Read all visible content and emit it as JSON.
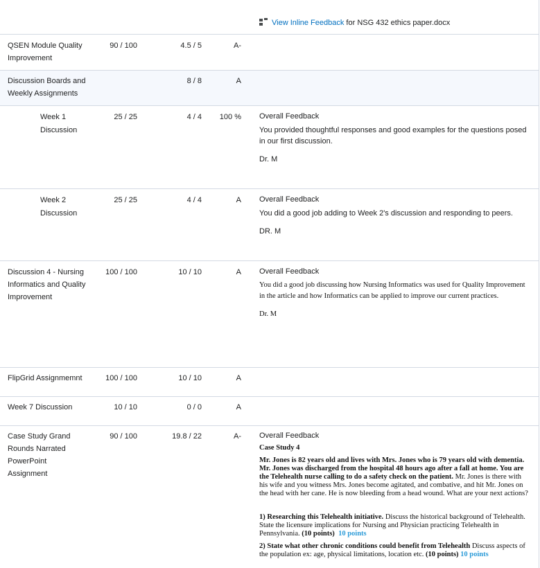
{
  "header": {
    "link_label": "View Inline Feedback",
    "link_suffix": " for NSG 432 ethics paper.docx"
  },
  "rows": {
    "qsen": {
      "name": "QSEN Module Quality Improvement",
      "points": "90 / 100",
      "weight": "4.5 / 5",
      "grade": "A-"
    },
    "discussion_boards": {
      "name": "Discussion Boards and Weekly Assignments",
      "points": "",
      "weight": "8 / 8",
      "grade": "A"
    },
    "week1": {
      "name": "Week 1 Discussion",
      "points": "25 / 25",
      "weight": "4 / 4",
      "grade": "100 %",
      "feedback_title": "Overall Feedback",
      "feedback_text": "You provided  thoughtful responses and good examples for the questions posed in our first discussion.",
      "feedback_sign": "Dr. M"
    },
    "week2": {
      "name": "Week 2 Discussion",
      "points": "25 / 25",
      "weight": "4 / 4",
      "grade": "A",
      "feedback_title": "Overall Feedback",
      "feedback_text": "You did a good job adding to Week 2's discussion and responding to peers.",
      "feedback_sign": "DR. M"
    },
    "disc4": {
      "name": "Discussion 4 - Nursing Informatics and Quality Improvement",
      "points": "100 / 100",
      "weight": "10 / 10",
      "grade": "A",
      "feedback_title": "Overall Feedback",
      "feedback_text": "You did a good job discussing how Nursing Informatics was used for Quality Improvement in the article and how Informatics can be applied to improve our current practices.",
      "feedback_sign": "Dr. M"
    },
    "flipgrid": {
      "name": "FlipGrid Assignmemnt",
      "points": "100 / 100",
      "weight": "10 / 10",
      "grade": "A"
    },
    "week7": {
      "name": "Week 7 Discussion",
      "points": "10 / 10",
      "weight": "0 / 0",
      "grade": "A"
    },
    "case_study": {
      "name": "Case Study Grand Rounds Narrated PowerPoint Assignment",
      "points": "90 / 100",
      "weight": "19.8 / 22",
      "grade": "A-",
      "feedback_title": "Overall Feedback",
      "case_title": "Case Study 4",
      "case_bold": "Mr. Jones is 82 years old and lives with Mrs. Jones who is 79 years old with dementia. Mr. Jones was discharged from the hospital 48 hours ago after a fall at home. You are the Telehealth nurse calling to do a safety check on the patient.",
      "case_plain": " Mr. Jones is there with his wife and you witness Mrs. Jones become agitated, and combative, and hit Mr. Jones on the head with her cane. He is now bleeding from a head wound. What are your next actions?",
      "q1_bold": "1) Researching this Telehealth initiative.",
      "q1_text": " Discuss the historical background of Telehealth. State the licensure implications for Nursing and Physician practicing Telehealth in Pennsylvania. ",
      "q1_pts": "(10 points)",
      "q1_score": "10 points",
      "q2_bold": "2) State what other chronic conditions could benefit from Telehealth",
      "q2_text": " Discuss aspects of the population ex: age, physical limitations, location etc. ",
      "q2_pts": "(10 points)",
      "q2_score": "10 points"
    }
  },
  "colors": {
    "link": "#006fbf",
    "highlight": "#2c9bd8",
    "border": "#d3d9e3",
    "category_bg": "#f5f8fd"
  },
  "icons": {
    "inline_feedback": "inline-feedback-icon"
  }
}
